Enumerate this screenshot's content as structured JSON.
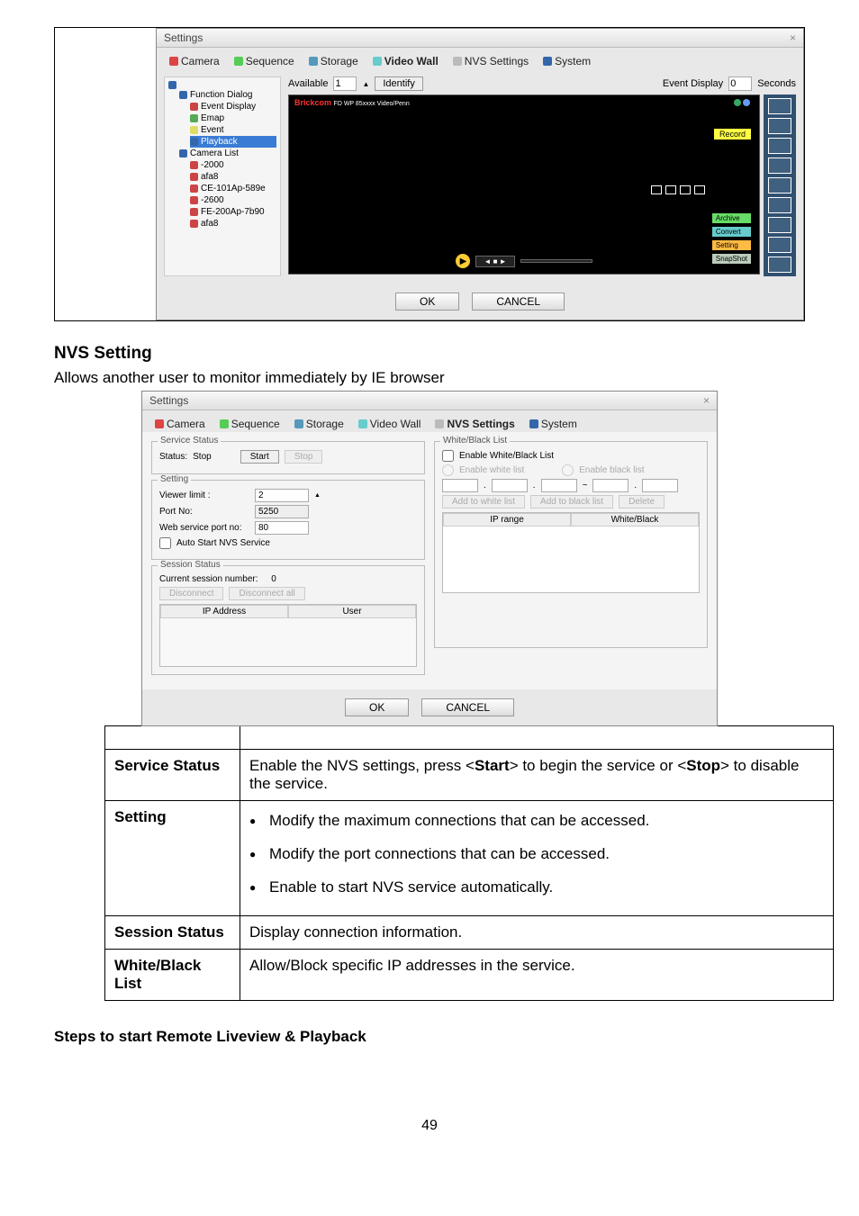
{
  "win": {
    "title": "Settings",
    "close": "×"
  },
  "tabs": {
    "camera": "Camera",
    "sequence": "Sequence",
    "storage": "Storage",
    "videowall": "Video Wall",
    "nvs": "NVS Settings",
    "system": "System"
  },
  "fig1": {
    "tree": {
      "node_function": "Function Dialog",
      "node_eventdisp": "Event Display",
      "node_emap": "Emap",
      "node_event": "Event",
      "node_playback": "Playback",
      "node_cameralist": "Camera List",
      "items": [
        "-2000",
        "afa8",
        "CE-101Ap-589e",
        "-2600",
        "FE-200Ap-7b90",
        "afa8"
      ]
    },
    "available": "Available",
    "avail_val": "1",
    "identify": "Identify",
    "eventdisplay": "Event Display",
    "seconds_val": "0",
    "seconds": "Seconds",
    "hdr_brand": "Brickcom",
    "hdr_text": "FD WP 85xxxx Video/Penn",
    "record": "Record",
    "lbl_archive": "Archive",
    "lbl_convert": "Convert",
    "lbl_setting": "Setting",
    "lbl_snapshot": "SnapShot",
    "play": "▶",
    "playtxt": "◄  ■  ►",
    "ok": "OK",
    "cancel": "CANCEL"
  },
  "section_h": "NVS Setting",
  "section_intro": "Allows another user to monitor immediately by IE browser",
  "fig2": {
    "g_service": "Service Status",
    "status_lbl": "Status:",
    "status_val": "Stop",
    "start": "Start",
    "stop": "Stop",
    "g_setting": "Setting",
    "viewer": "Viewer limit :",
    "viewer_val": "2",
    "port": "Port No:",
    "port_val": "5250",
    "webport": "Web service port no:",
    "webport_val": "80",
    "autostart": "Auto Start NVS Service",
    "g_session": "Session Status",
    "cur_sess": "Current session number:",
    "cur_val": "0",
    "disc": "Disconnect",
    "disc_all": "Disconnect all",
    "col_ip": "IP Address",
    "col_user": "User",
    "g_wb": "White/Black List",
    "en_wb": "Enable White/Black List",
    "en_white": "Enable white list",
    "en_black": "Enable black list",
    "add_white": "Add to white list",
    "add_black": "Add to black list",
    "del": "Delete",
    "col_range": "IP range",
    "col_wb": "White/Black",
    "ok": "OK",
    "cancel": "CANCEL"
  },
  "rows": {
    "r1k": "Service Status",
    "r1v1": "Enable the NVS settings, press <",
    "r1v2": "Start",
    "r1v3": "> to begin the service or <",
    "r1v4": "Stop",
    "r1v5": "> to disable the service.",
    "r2k": "Setting",
    "r2b1": "Modify the maximum connections that can be accessed.",
    "r2b2": "Modify the port connections that can be accessed.",
    "r2b3": "Enable to start NVS service automatically.",
    "r3k": "Session Status",
    "r3v": "Display connection information.",
    "r4k": "White/Black List",
    "r4v": "Allow/Block specific IP addresses in the service."
  },
  "steps_h": "Steps to start Remote Liveview & Playback",
  "page": "49"
}
